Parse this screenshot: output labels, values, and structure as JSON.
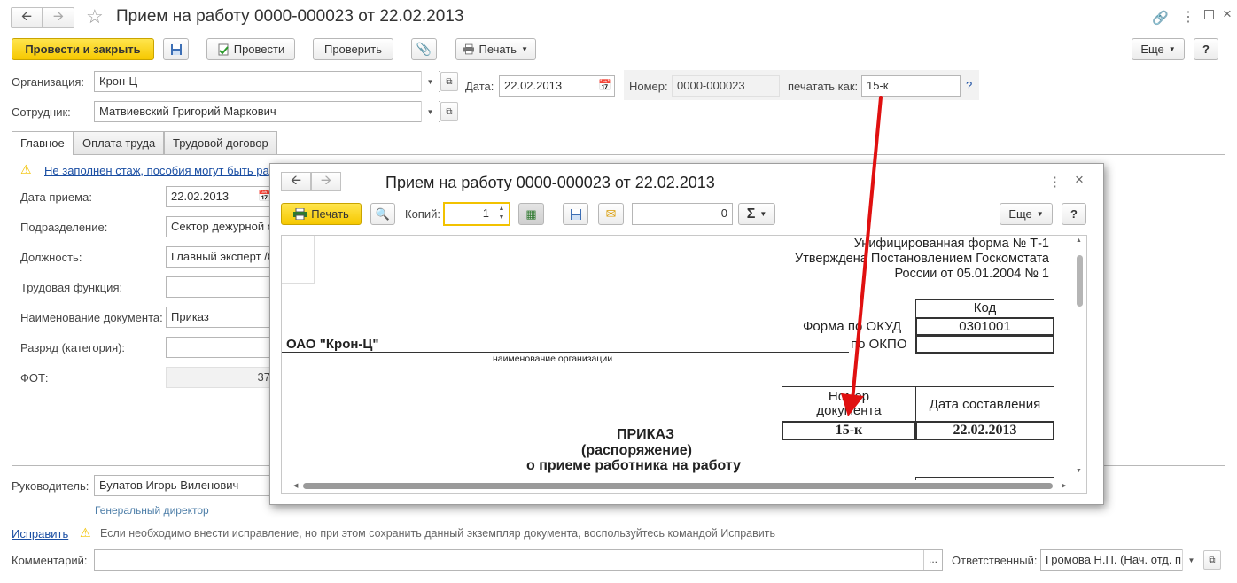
{
  "window": {
    "title": "Прием на работу 0000-000023 от 22.02.2013"
  },
  "toolbar": {
    "post_close": "Провести и закрыть",
    "post": "Провести",
    "check": "Проверить",
    "print": "Печать",
    "more": "Еще",
    "help": "?"
  },
  "header": {
    "org_label": "Организация:",
    "org_value": "Крон-Ц",
    "date_label": "Дата:",
    "date_value": "22.02.2013",
    "number_label": "Номер:",
    "number_value": "0000-000023",
    "print_as_label": "печатать как:",
    "print_as_value": "15-к",
    "help_mark": "?",
    "employee_label": "Сотрудник:",
    "employee_value": "Матвиевский Григорий Маркович"
  },
  "tabs": [
    "Главное",
    "Оплата труда",
    "Трудовой договор"
  ],
  "main": {
    "warning_link": "Не заполнен стаж, пособия могут быть ра",
    "hire_date_label": "Дата приема:",
    "hire_date_value": "22.02.2013",
    "department_label": "Подразделение:",
    "department_value": "Сектор дежурной с",
    "position_label": "Должность:",
    "position_value": "Главный эксперт /С",
    "labor_function_label": "Трудовая функция:",
    "labor_function_value": "",
    "doc_name_label": "Наименование документа:",
    "doc_name_value": "Приказ",
    "category_label": "Разряд (категория):",
    "category_value": "",
    "fot_label": "ФОТ:",
    "fot_value": "37"
  },
  "footer": {
    "manager_label": "Руководитель:",
    "manager_value": "Булатов Игорь Виленович",
    "manager_position": "Генеральный директор",
    "fix_link": "Исправить",
    "fix_hint": "Если необходимо внести исправление, но при этом сохранить данный экземпляр документа, воспользуйтесь командой Исправить",
    "comment_label": "Комментарий:",
    "comment_value": "",
    "comment_ellipsis": "...",
    "responsible_label": "Ответственный:",
    "responsible_value": "Громова Н.П. (Нач. отд. п"
  },
  "popup": {
    "title": "Прием на работу 0000-000023 от 22.02.2013",
    "print": "Печать",
    "copies_label": "Копий:",
    "copies_value": "1",
    "sum_value": "0",
    "sigma": "Σ",
    "more": "Еще",
    "help": "?"
  },
  "report": {
    "form_line1": "Унифицированная форма № Т-1",
    "form_line2": "Утверждена Постановлением Госкомстата",
    "form_line3": "России от 05.01.2004 № 1",
    "code_header": "Код",
    "okud_label": "Форма по ОКУД",
    "okud_value": "0301001",
    "okpo_label": "по ОКПО",
    "okpo_value": "",
    "org_name": "ОАО \"Крон-Ц\"",
    "org_caption": "наименование организации",
    "num_header_1": "Номер",
    "num_header_2": "документа",
    "date_header": "Дата составления",
    "doc_number": "15-к",
    "doc_date": "22.02.2013",
    "order_title": "ПРИКАЗ",
    "order_sub": "(распоряжение)",
    "order_desc": "о приеме работника на работу"
  },
  "colors": {
    "accent_yellow": "#f6c800",
    "link_blue": "#1a4ea3",
    "arrow_red": "#e01010",
    "warning_yellow": "#f2c200"
  }
}
